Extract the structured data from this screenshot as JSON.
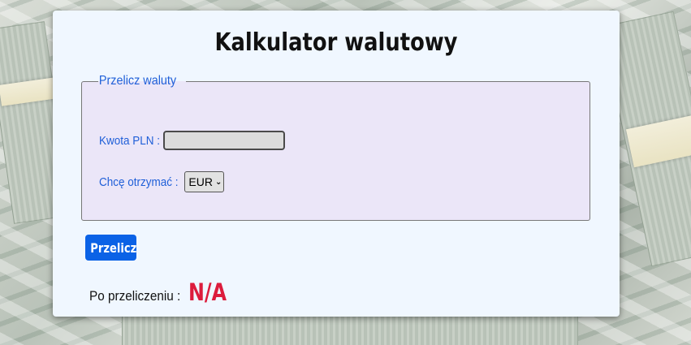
{
  "page": {
    "title": "Kalkulator walutowy"
  },
  "form": {
    "legend": "Przelicz waluty",
    "amount_label": "Kwota PLN :",
    "amount_value": "",
    "currency_label": "Chcę otrzymać :",
    "currency_selected": "EUR"
  },
  "actions": {
    "convert_label": "Przelicz"
  },
  "result": {
    "label": "Po przeliczeniu :",
    "value": "N/A"
  },
  "colors": {
    "card_background": "#f0f7ff",
    "fieldset_background": "#ebe6f8",
    "label_blue": "#1f5fd8",
    "button_blue": "#0b62e6",
    "result_red": "#dc1c3c"
  }
}
